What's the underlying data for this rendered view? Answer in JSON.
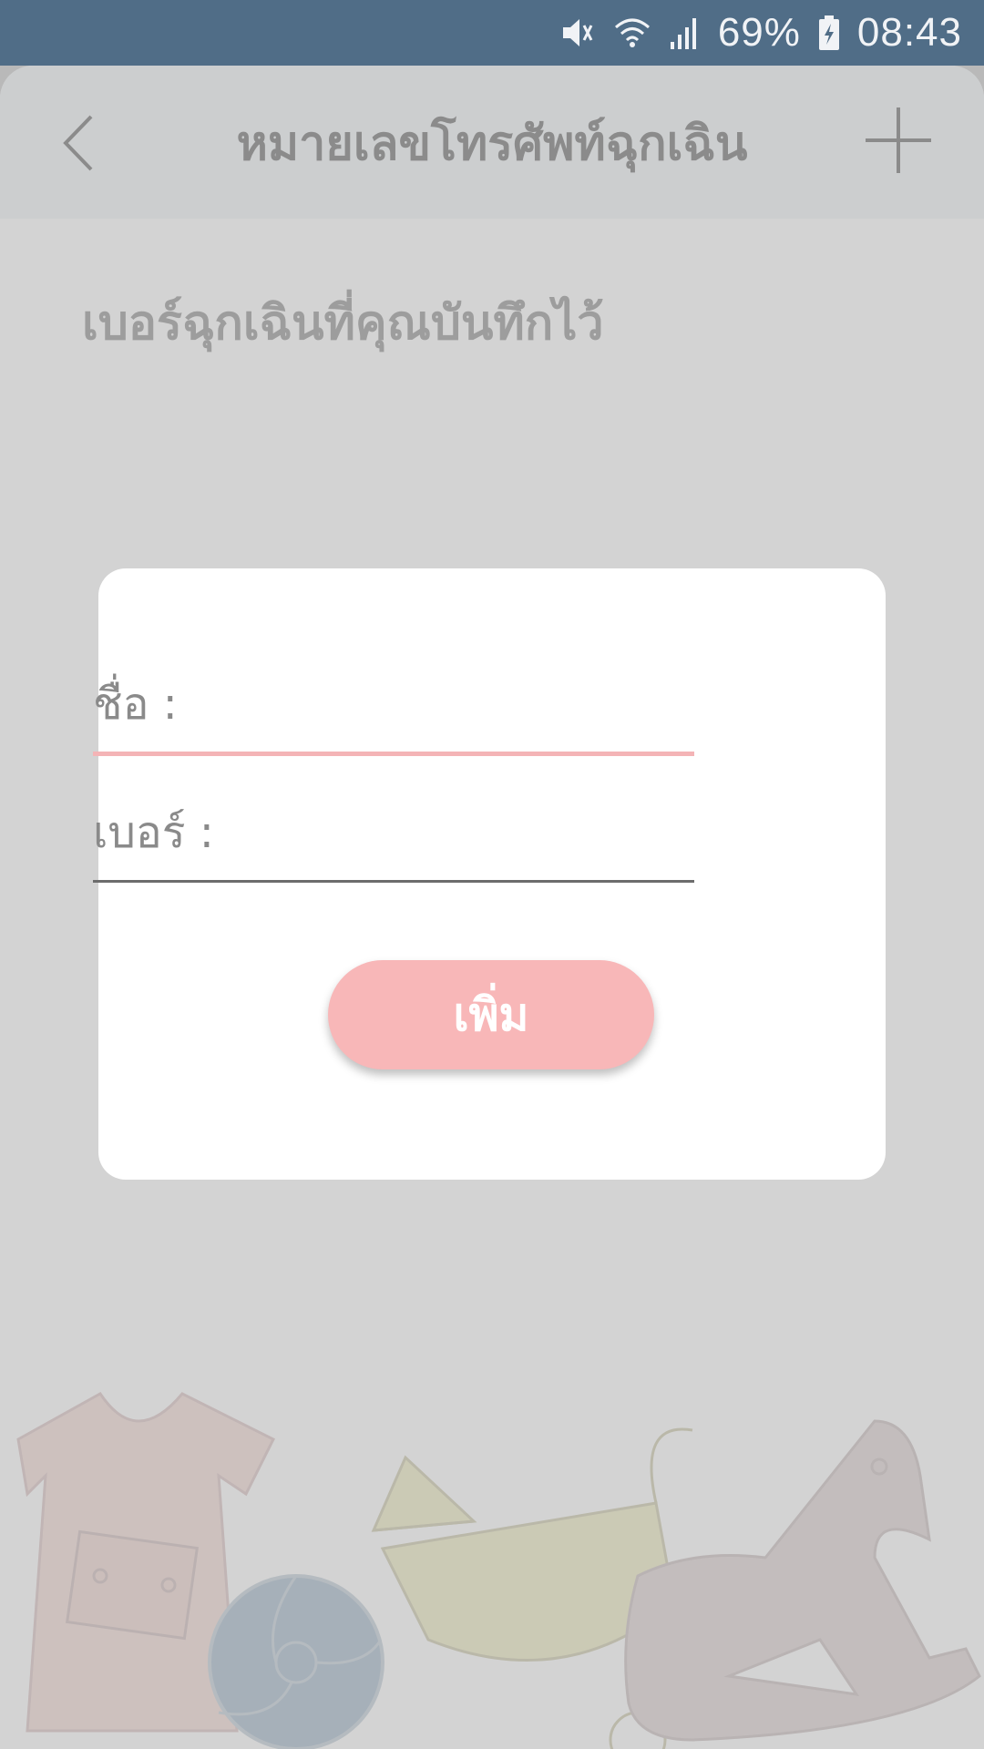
{
  "status_bar": {
    "battery_percent": "69%",
    "time": "08:43",
    "icons": [
      "mute-icon",
      "wifi-icon",
      "signal-icon",
      "battery-charging-icon"
    ]
  },
  "header": {
    "title": "หมายเลขโทรศัพท์ฉุกเฉิน",
    "back_icon": "chevron-left-icon",
    "add_icon": "plus-icon"
  },
  "main": {
    "section_title": "เบอร์ฉุกเฉินที่คุณบันทึกไว้"
  },
  "dialog": {
    "name_label": "ชื่อ :",
    "name_value": "",
    "phone_label": "เบอร์ :",
    "phone_value": "",
    "submit_label": "เพิ่ม"
  },
  "colors": {
    "status_bar": "#506d87",
    "accent_pink": "#f8b7b8",
    "overlay": "#d6d6d6"
  }
}
